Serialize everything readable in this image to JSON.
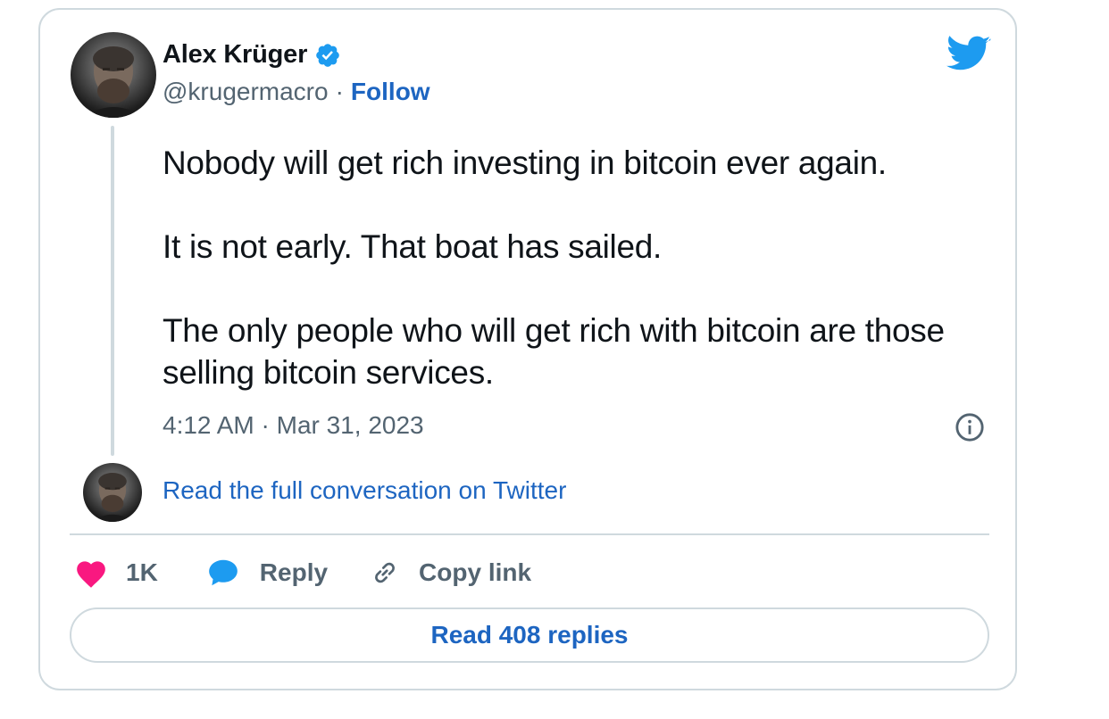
{
  "author": {
    "name": "Alex Krüger",
    "handle": "@krugermacro",
    "separator": "·",
    "follow_label": "Follow"
  },
  "tweet": {
    "paragraphs": [
      "Nobody will get rich investing in bitcoin ever again.",
      "It is not early. That boat has sailed.",
      "The only people who will get rich with bitcoin are those selling bitcoin services."
    ],
    "timestamp": "4:12 AM · Mar 31, 2023"
  },
  "conversation_link": "Read the full conversation on Twitter",
  "actions": {
    "like_count": "1K",
    "reply_label": "Reply",
    "copy_link_label": "Copy link"
  },
  "replies_button": "Read 408 replies",
  "icons": {
    "brand": "twitter-bird-icon",
    "verified": "verified-badge-icon",
    "info": "info-icon",
    "like": "heart-icon",
    "reply": "reply-bubble-icon",
    "copy": "link-icon"
  },
  "colors": {
    "brand_blue": "#1d9bf0",
    "link_blue": "#1d65c1",
    "heart_pink": "#f91880",
    "text_primary": "#0f1419",
    "text_secondary": "#536471",
    "border": "#cfd9de"
  }
}
